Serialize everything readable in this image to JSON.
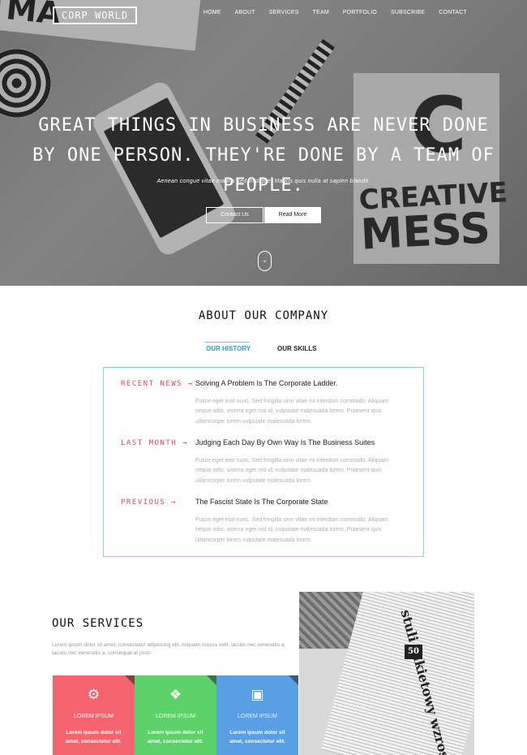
{
  "header": {
    "logo": "CORP WORLD",
    "nav": [
      "HOME",
      "ABOUT",
      "SERVICES",
      "TEAM",
      "PORTFOLIO",
      "SUBSCRIBE",
      "CONTACT"
    ]
  },
  "hero": {
    "headline": "GREAT THINGS IN BUSINESS ARE NEVER DONE BY ONE PERSON. THEY'RE DONE BY A TEAM OF PEOPLE.",
    "subline": "Aenean congue vitae mauris sed tristique. Mauris quis nulla at sapien blandit.",
    "contact_label": "Contact Us",
    "read_label": "Read More",
    "scroll_icon": "chevron-down-icon",
    "image_text": {
      "creative": "CREATIVE",
      "mess": "MESS",
      "letter": "C",
      "magazine": "MA"
    }
  },
  "about": {
    "title": "ABOUT OUR COMPANY",
    "tabs": [
      "OUR HISTORY",
      "OUR SKILLS"
    ],
    "active_tab": "OUR HISTORY",
    "items": [
      {
        "tag": "RECENT NEWS →",
        "heading": "Solving A Problem Is The Corporate Ladder.",
        "body": "Fusce eget erat nunc. Sed fringilla sem vitae mi interdum commodo. Aliquam neque odio, viverra eget nisl id, vulputate malesuada lorem. Praesent quis ullamcorper lorem vulputate malesuada lorem."
      },
      {
        "tag": "LAST MONTH →",
        "heading": "Judging Each Day By Own Way Is The Business Suites",
        "body": "Fusce eget erat nunc. Sed fringilla sem vitae mi interdum commodo. Aliquam neque odio, viverra eget nisl id, vulputate malesuada lorem. Praesent quis ullamcorper lorem vulputate malesuada lorem."
      },
      {
        "tag": "PREVIOUS →",
        "heading": "The Fascist State Is The Corporate State",
        "body": "Fusce eget erat nunc. Sed fringilla sem vitae mi interdum commodo. Aliquam neque odio, viverra eget nisl id, vulputate malesuada lorem. Praesent quis ullamcorper lorem vulputate malesuada lorem."
      }
    ]
  },
  "services": {
    "title": "OUR SERVICES",
    "description": "Lorem ipsum dolor sit amet, consectetur adipiscing elit. Aliquam massa velit, iaculis nec venenatis a, iaculis nec venenatis a, consequat at justo.",
    "cards": [
      {
        "icon": "gears-icon",
        "glyph": "⚙",
        "title": "LOREM IPSUM",
        "text": "Lorem ipsum dolor sit amet, consectetur elit.",
        "color": "#f4646e"
      },
      {
        "icon": "cubes-icon",
        "glyph": "❖",
        "title": "LOREM IPSUM",
        "text": "Lorem ipsum dolor sit amet, consectetur elit.",
        "color": "#5dd16a"
      },
      {
        "icon": "briefcase-icon",
        "glyph": "▣",
        "title": "LOREM IPSUM",
        "text": "Lorem ipsum dolor sit amet, consectetur elit.",
        "color": "#5a9ee3"
      }
    ],
    "image_text": {
      "headline": "stuli rakietowy wzrost",
      "badge": "50"
    }
  },
  "colors": {
    "accent_blue": "#2a9fd6",
    "accent_red": "#e0475b",
    "timeline_border": "#8ccff0"
  }
}
